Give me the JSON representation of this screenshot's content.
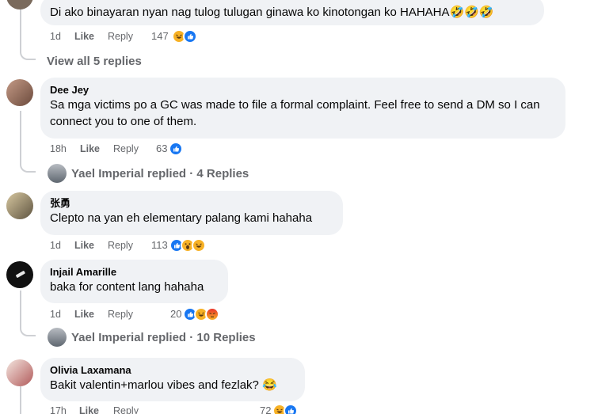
{
  "comments": [
    {
      "text": "Di ako binayaran nyan nag tulog tulugan ginawa ko kinotongan ko HAHAHA🤣🤣🤣",
      "time": "1d",
      "like": "Like",
      "reply": "Reply",
      "count": "147",
      "reactions": [
        "haha-icon",
        "like-icon"
      ]
    },
    {
      "author": "Dee Jey",
      "text": "Sa mga victims po a GC was made to file a formal complaint. Feel free to send a DM so I can connect you to one of them.",
      "time": "18h",
      "like": "Like",
      "reply": "Reply",
      "count": "63",
      "reactions": [
        "like-icon"
      ]
    },
    {
      "author": "张勇",
      "text": "Clepto na yan eh elementary palang kami hahaha",
      "time": "1d",
      "like": "Like",
      "reply": "Reply",
      "count": "113",
      "reactions": [
        "like-icon",
        "wow-icon",
        "haha-icon"
      ]
    },
    {
      "author": "Injail Amarille",
      "text": "baka for content lang hahaha",
      "time": "1d",
      "like": "Like",
      "reply": "Reply",
      "count": "20",
      "reactions": [
        "like-icon",
        "haha-icon",
        "angry-icon"
      ]
    },
    {
      "author": "Olivia Laxamana",
      "text": "Bakit valentin+marlou vibes and fezlak? 😂",
      "time": "17h",
      "like": "Like",
      "reply": "Reply",
      "count": "72",
      "reactions": [
        "haha-icon",
        "like-icon"
      ]
    }
  ],
  "reply_links": {
    "view_all": "View all 5 replies",
    "yael_4": "Yael Imperial replied · 4 Replies",
    "yael_10": "Yael Imperial replied · 10 Replies"
  },
  "colors": {
    "bubble": "#f0f2f5",
    "secondary_text": "#65676b",
    "like_blue": "#1877f2",
    "haha_yellow": "#f7b125",
    "angry_red": "#e9710f"
  }
}
